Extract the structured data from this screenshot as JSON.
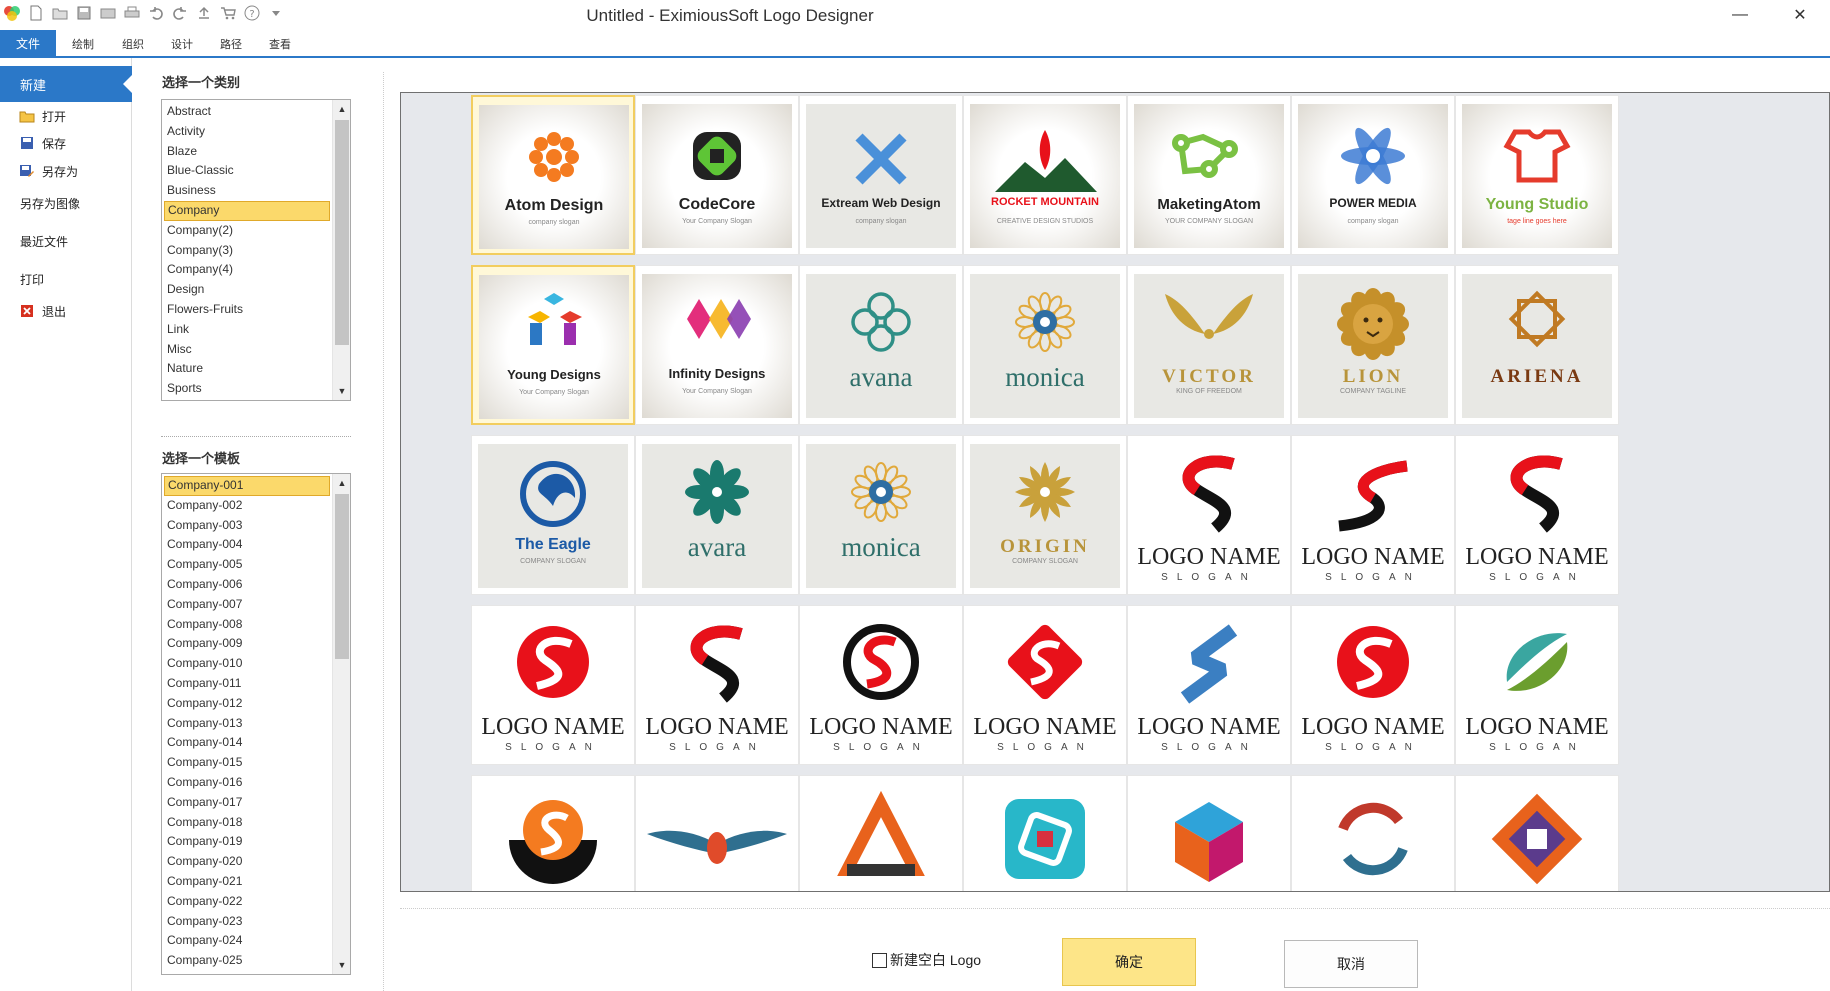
{
  "window": {
    "title": "Untitled - EximiousSoft Logo Designer",
    "minimize_label": "—",
    "close_label": "✕"
  },
  "ribbon": {
    "tabs": [
      "文件",
      "绘制",
      "组织",
      "设计",
      "路径",
      "查看"
    ]
  },
  "backstage": {
    "items": [
      {
        "label": "新建",
        "icon": "new-icon"
      },
      {
        "label": "打开",
        "icon": "open-folder-icon"
      },
      {
        "label": "保存",
        "icon": "save-icon"
      },
      {
        "label": "另存为",
        "icon": "save-as-icon"
      },
      {
        "label": "另存为图像",
        "icon": ""
      },
      {
        "label": "最近文件",
        "icon": ""
      },
      {
        "label": "打印",
        "icon": ""
      },
      {
        "label": "退出",
        "icon": "exit-icon"
      }
    ]
  },
  "category_pane": {
    "label": "选择一个类别",
    "items": [
      "Abstract",
      "Activity",
      "Blaze",
      "Blue-Classic",
      "Business",
      "Company",
      "Company(2)",
      "Company(3)",
      "Company(4)",
      "Design",
      "Flowers-Fruits",
      "Link",
      "Misc",
      "Nature",
      "Sports"
    ],
    "selected": "Company"
  },
  "template_pane": {
    "label": "选择一个模板",
    "items": [
      "Company-001",
      "Company-002",
      "Company-003",
      "Company-004",
      "Company-005",
      "Company-006",
      "Company-007",
      "Company-008",
      "Company-009",
      "Company-010",
      "Company-011",
      "Company-012",
      "Company-013",
      "Company-014",
      "Company-015",
      "Company-016",
      "Company-017",
      "Company-018",
      "Company-019",
      "Company-020",
      "Company-021",
      "Company-022",
      "Company-023",
      "Company-024",
      "Company-025"
    ],
    "selected": "Company-001"
  },
  "gallery": {
    "tiles": [
      {
        "name": "Atom Design",
        "slogan": "company slogan",
        "icon": "atom-flower-icon"
      },
      {
        "name": "CodeCore",
        "slogan": "Your Company Slogan",
        "icon": "codecore-icon"
      },
      {
        "name": "Extream Web Design",
        "slogan": "company slogan",
        "icon": "x-shape-icon"
      },
      {
        "name": "ROCKET MOUNTAIN",
        "slogan": "CREATIVE DESIGN STUDIOS",
        "icon": "rocket-mountain-icon"
      },
      {
        "name": "MaketingAtom",
        "slogan": "YOUR COMPANY SLOGAN",
        "icon": "molecule-icon"
      },
      {
        "name": "POWER MEDIA",
        "slogan": "company slogan",
        "icon": "snowflake-icon"
      },
      {
        "name": "Young Studio",
        "slogan": "tage line goes here",
        "icon": "shirt-icon"
      },
      {
        "name": "Young Designs",
        "slogan": "Your Company Slogan",
        "icon": "cubes-icon"
      },
      {
        "name": "Infinity Designs",
        "slogan": "Your Company Slogan",
        "icon": "infinity-icon"
      },
      {
        "name": "avana",
        "slogan": "",
        "icon": "knot-icon"
      },
      {
        "name": "monica",
        "slogan": "",
        "icon": "mandala-icon"
      },
      {
        "name": "VICTOR",
        "slogan": "KING OF FREEDOM",
        "icon": "wings-icon"
      },
      {
        "name": "LION",
        "slogan": "COMPANY TAGLINE",
        "icon": "lion-icon"
      },
      {
        "name": "ARIENA",
        "slogan": "",
        "icon": "star-knot-icon"
      },
      {
        "name": "The Eagle",
        "slogan": "COMPANY SLOGAN",
        "icon": "eagle-icon"
      },
      {
        "name": "avara",
        "slogan": "",
        "icon": "leaf-star-icon"
      },
      {
        "name": "monica",
        "slogan": "",
        "icon": "mandala-icon"
      },
      {
        "name": "ORIGIN",
        "slogan": "COMPANY SLOGAN",
        "icon": "sunburst-icon"
      },
      {
        "name": "LOGO NAME",
        "slogan": "SLOGAN",
        "icon": "s-letter-icon"
      },
      {
        "name": "LOGO NAME",
        "slogan": "SLOGAN",
        "icon": "s-swoosh-icon"
      },
      {
        "name": "LOGO NAME",
        "slogan": "SLOGAN",
        "icon": "s-letter-icon"
      },
      {
        "name": "LOGO NAME",
        "slogan": "SLOGAN",
        "icon": "s-circle-icon"
      },
      {
        "name": "LOGO NAME",
        "slogan": "SLOGAN",
        "icon": "s-letter-icon"
      },
      {
        "name": "LOGO NAME",
        "slogan": "SLOGAN",
        "icon": "s-ring-icon"
      },
      {
        "name": "LOGO NAME",
        "slogan": "SLOGAN",
        "icon": "s-diamond-icon"
      },
      {
        "name": "LOGO NAME",
        "slogan": "SLOGAN",
        "icon": "s-ribbon-icon"
      },
      {
        "name": "LOGO NAME",
        "slogan": "SLOGAN",
        "icon": "s-circle-icon"
      },
      {
        "name": "LOGO NAME",
        "slogan": "SLOGAN",
        "icon": "s-leaf-icon"
      },
      {
        "name": "",
        "slogan": "",
        "icon": "bowl-s-icon"
      },
      {
        "name": "",
        "slogan": "",
        "icon": "winged-eye-icon"
      },
      {
        "name": "",
        "slogan": "",
        "icon": "triangle-icon"
      },
      {
        "name": "",
        "slogan": "",
        "icon": "square-target-icon"
      },
      {
        "name": "",
        "slogan": "",
        "icon": "cube-icon"
      },
      {
        "name": "",
        "slogan": "",
        "icon": "circular-arrows-icon"
      },
      {
        "name": "",
        "slogan": "",
        "icon": "diamond-square-icon"
      }
    ]
  },
  "footer": {
    "blank_logo_label": "新建空白 Logo",
    "blank_logo_checked": false,
    "ok_label": "确定",
    "cancel_label": "取消"
  },
  "colors": {
    "accent": "#2b78c8",
    "selection": "#fbd96b",
    "logo_red": "#e8111a",
    "logo_orange": "#f47b20"
  }
}
